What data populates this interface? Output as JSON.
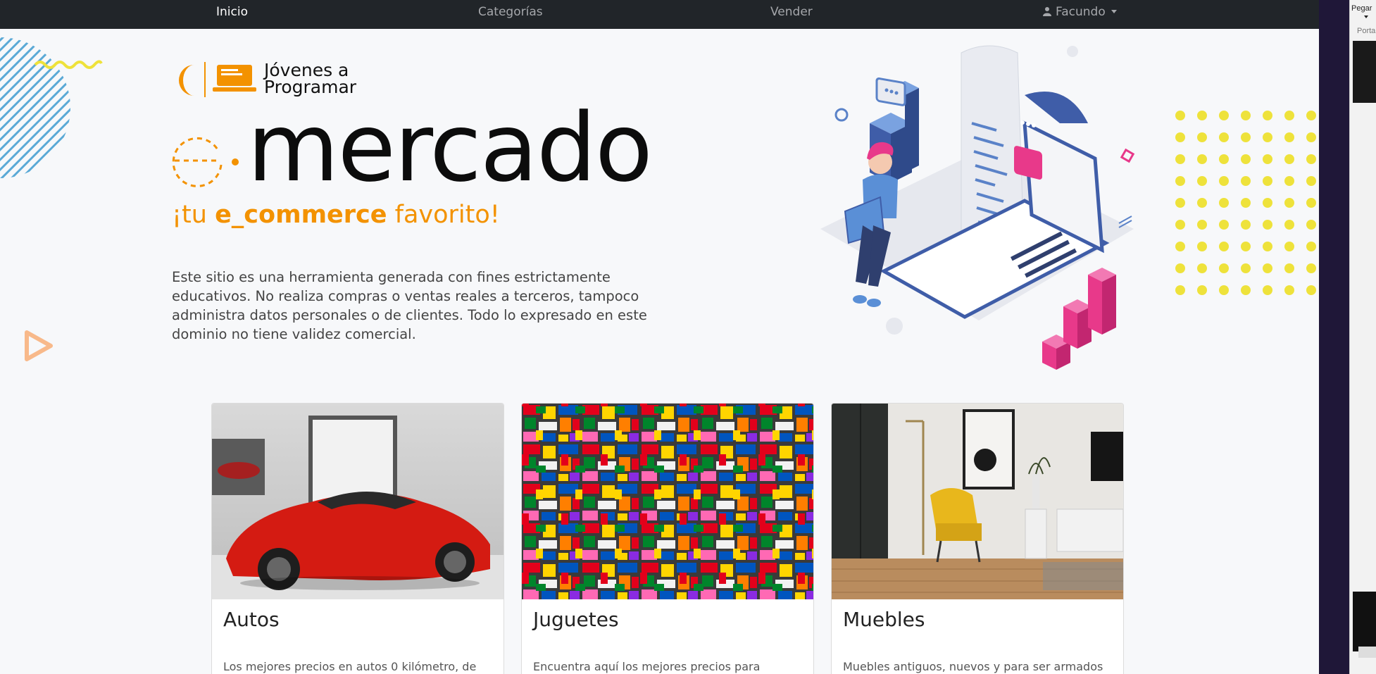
{
  "nav": {
    "items": [
      {
        "label": "Inicio",
        "active": true
      },
      {
        "label": "Categorías",
        "active": false
      },
      {
        "label": "Vender",
        "active": false
      }
    ],
    "user": {
      "name": "Facundo",
      "icon": "user-icon"
    }
  },
  "hero": {
    "logo_line1": "Jóvenes a",
    "logo_line2": "Programar",
    "brand": "mercado",
    "tagline_pre": "¡tu ",
    "tagline_bold": "e_commerce",
    "tagline_post": " favorito!",
    "disclaimer": "Este sitio es una herramienta generada con fines estrictamente educativos. No realiza compras o ventas reales a terceros, tampoco administra datos personales o de clientes. Todo lo expresado en este dominio no tiene validez comercial."
  },
  "categories": [
    {
      "title": "Autos",
      "text": "Los mejores precios en autos 0 kilómetro, de"
    },
    {
      "title": "Juguetes",
      "text": "Encuentra aquí los mejores precios para"
    },
    {
      "title": "Muebles",
      "text": "Muebles antiguos, nuevos y para ser armados"
    }
  ],
  "side_panel": {
    "label1": "Pegar",
    "label2": "Porta"
  },
  "colors": {
    "accent": "#f39200",
    "navbar": "#212529",
    "page_bg": "#f7f8fa",
    "dots": "#eee23b",
    "pink": "#e8398a",
    "blue": "#3f5da8"
  }
}
